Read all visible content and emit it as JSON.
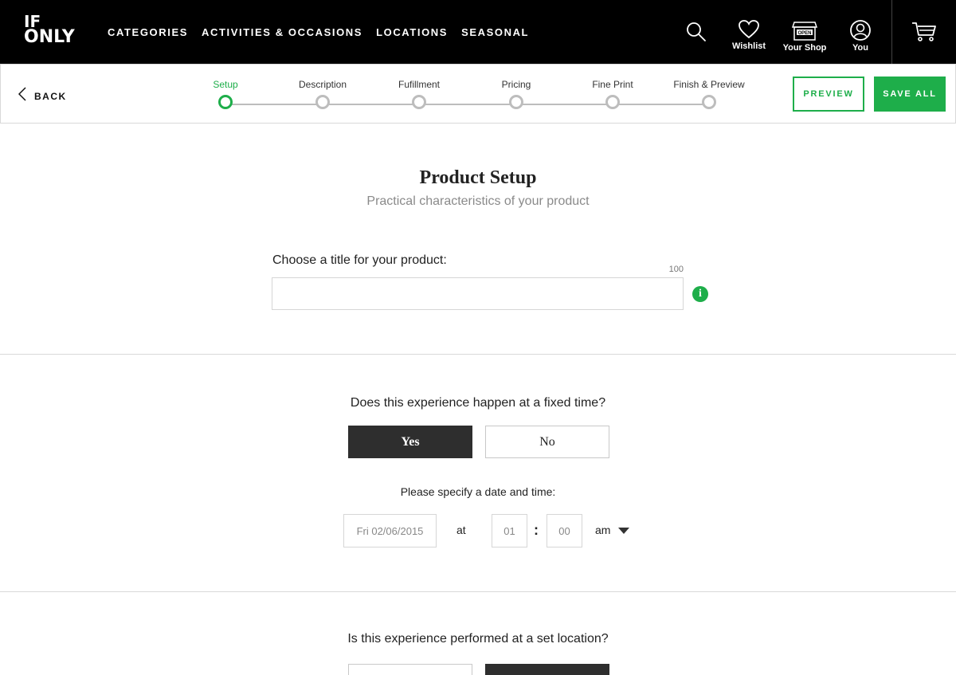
{
  "header": {
    "logo_line1": "IF",
    "logo_line2": "ONLY",
    "nav": [
      "CATEGORIES",
      "ACTIVITIES & OCCASIONS",
      "LOCATIONS",
      "SEASONAL"
    ],
    "wishlist_label": "Wishlist",
    "shop_label": "Your Shop",
    "shop_sign": "OPEN",
    "you_label": "You",
    "icons": {
      "search": "search-icon",
      "wishlist": "heart-icon",
      "shop": "storefront-icon",
      "you": "user-icon",
      "cart": "cart-icon"
    }
  },
  "subbar": {
    "back_label": "BACK",
    "steps": [
      "Setup",
      "Description",
      "Fufillment",
      "Pricing",
      "Fine Print",
      "Finish & Preview"
    ],
    "active_step": 0,
    "preview_label": "PREVIEW",
    "save_label": "SAVE ALL"
  },
  "main": {
    "title": "Product Setup",
    "subtitle": "Practical characteristics of your product",
    "title_field": {
      "label": "Choose a title for your product:",
      "char_limit": "100",
      "value": "",
      "info_glyph": "i"
    },
    "fixed_time": {
      "question": "Does this experience happen at a fixed time?",
      "yes": "Yes",
      "no": "No",
      "selected": "Yes",
      "specify_label": "Please specify a date and time:",
      "date": "Fri 02/06/2015",
      "at": "at",
      "hour": "01",
      "colon": ":",
      "minute": "00",
      "ampm": "am"
    },
    "location": {
      "question": "Is this experience performed at a set location?",
      "selected": "No"
    }
  },
  "colors": {
    "accent": "#1eae4a",
    "header_bg": "#000000",
    "selected_option": "#2e2e2e"
  }
}
